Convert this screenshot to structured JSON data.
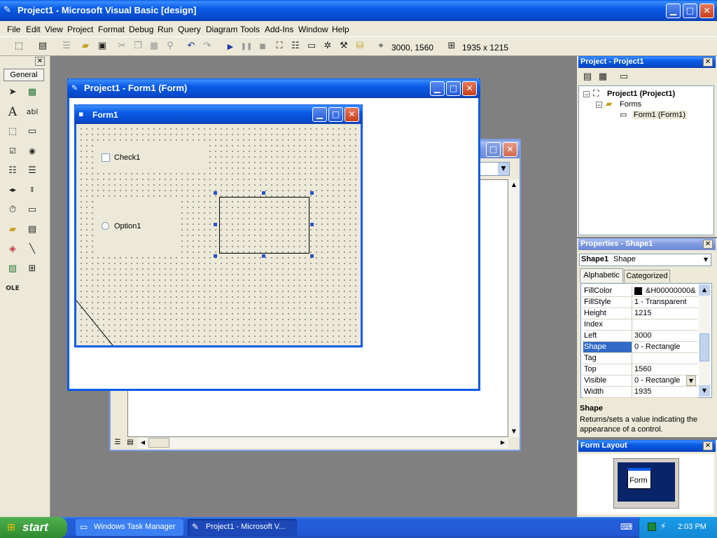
{
  "window": {
    "title": "Project1 - Microsoft Visual Basic [design]"
  },
  "menu": [
    "File",
    "Edit",
    "View",
    "Project",
    "Format",
    "Debug",
    "Run",
    "Query",
    "Diagram",
    "Tools",
    "Add-Ins",
    "Window",
    "Help"
  ],
  "toolbar": {
    "position": "3000, 1560",
    "size": "1935 x 1215"
  },
  "toolbox": {
    "tab": "General"
  },
  "designer": {
    "title": "Project1 - Form1 (Form)"
  },
  "form": {
    "title": "Form1",
    "check_label": "Check1",
    "option_label": "Option1"
  },
  "project_explorer": {
    "title": "Project - Project1",
    "root": "Project1 (Project1)",
    "folder": "Forms",
    "item": "Form1 (Form1)"
  },
  "properties": {
    "title": "Properties - Shape1",
    "object_name": "Shape1",
    "object_type": "Shape",
    "tab_alpha": "Alphabetic",
    "tab_cat": "Categorized",
    "rows": [
      {
        "name": "FillColor",
        "value": "&H00000000&"
      },
      {
        "name": "FillStyle",
        "value": "1 - Transparent"
      },
      {
        "name": "Height",
        "value": "1215"
      },
      {
        "name": "Index",
        "value": ""
      },
      {
        "name": "Left",
        "value": "3000"
      },
      {
        "name": "Shape",
        "value": "0 - Rectangle"
      },
      {
        "name": "Tag",
        "value": ""
      },
      {
        "name": "Top",
        "value": "1560"
      },
      {
        "name": "Visible",
        "value": "0 - Rectangle"
      },
      {
        "name": "Width",
        "value": "1935"
      }
    ],
    "selected_row": 5,
    "desc_title": "Shape",
    "desc_text": "Returns/sets a value indicating the appearance of a control."
  },
  "form_layout": {
    "title": "Form Layout",
    "preview_label": "Form"
  },
  "taskbar": {
    "start_label": "start",
    "items": [
      "Windows Task Manager",
      "Project1 - Microsoft V..."
    ],
    "clock": "2:03 PM"
  },
  "colors": {
    "xp_blue": "#0a5ce6",
    "taskbar_blue": "#245edb",
    "start_green": "#3c9a3c",
    "selection": "#316ac5",
    "face": "#ece9d8"
  }
}
